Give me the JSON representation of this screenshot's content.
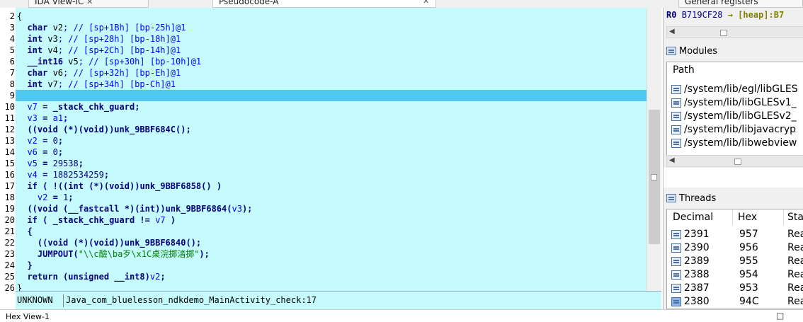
{
  "tabs": [
    {
      "label": "IDA View-IC",
      "close": "✕"
    },
    {
      "label": "Pseudocode-A",
      "close": "✕"
    },
    {
      "label": "General registers",
      "close": ""
    }
  ],
  "code_lines": [
    {
      "n": "2",
      "segments": [
        {
          "t": "{",
          "c": ""
        }
      ]
    },
    {
      "n": "3",
      "segments": [
        {
          "t": "  char ",
          "c": "kw"
        },
        {
          "t": "v2",
          "c": ""
        },
        {
          "t": "; // [sp+1Bh] [bp-25h]@1",
          "c": "cmt"
        }
      ]
    },
    {
      "n": "4",
      "segments": [
        {
          "t": "  int ",
          "c": "kw"
        },
        {
          "t": "v3",
          "c": ""
        },
        {
          "t": "; // [sp+28h] [bp-18h]@1",
          "c": "cmt"
        }
      ]
    },
    {
      "n": "5",
      "segments": [
        {
          "t": "  int ",
          "c": "kw"
        },
        {
          "t": "v4",
          "c": ""
        },
        {
          "t": "; // [sp+2Ch] [bp-14h]@1",
          "c": "cmt"
        }
      ]
    },
    {
      "n": "6",
      "segments": [
        {
          "t": "  __int16 ",
          "c": "kw"
        },
        {
          "t": "v5",
          "c": ""
        },
        {
          "t": "; // [sp+30h] [bp-10h]@1",
          "c": "cmt"
        }
      ]
    },
    {
      "n": "7",
      "segments": [
        {
          "t": "  char ",
          "c": "kw"
        },
        {
          "t": "v6",
          "c": ""
        },
        {
          "t": "; // [sp+32h] [bp-Eh]@1",
          "c": "cmt"
        }
      ]
    },
    {
      "n": "8",
      "segments": [
        {
          "t": "  int ",
          "c": "kw"
        },
        {
          "t": "v7",
          "c": ""
        },
        {
          "t": "; // [sp+34h] [bp-Ch]@1",
          "c": "cmt"
        }
      ]
    },
    {
      "n": "9",
      "segments": [
        {
          "t": "",
          "c": ""
        }
      ],
      "selected": true
    },
    {
      "n": "10",
      "segments": [
        {
          "t": "  v7",
          "c": "var"
        },
        {
          "t": " = ",
          "c": "op"
        },
        {
          "t": "_stack_chk_guard",
          "c": "fn"
        },
        {
          "t": ";",
          "c": "op"
        }
      ]
    },
    {
      "n": "11",
      "segments": [
        {
          "t": "  v3",
          "c": "var"
        },
        {
          "t": " = ",
          "c": "op"
        },
        {
          "t": "a1",
          "c": "var"
        },
        {
          "t": ";",
          "c": "op"
        }
      ]
    },
    {
      "n": "12",
      "segments": [
        {
          "t": "  ((",
          "c": "op"
        },
        {
          "t": "void",
          "c": "kw"
        },
        {
          "t": " (*)(",
          "c": "op"
        },
        {
          "t": "void",
          "c": "kw"
        },
        {
          "t": "))",
          "c": "op"
        },
        {
          "t": "unk_9BBF684C",
          "c": "fn"
        },
        {
          "t": "();",
          "c": "op"
        }
      ]
    },
    {
      "n": "13",
      "segments": [
        {
          "t": "  v2",
          "c": "var"
        },
        {
          "t": " = ",
          "c": "op"
        },
        {
          "t": "0",
          "c": "num"
        },
        {
          "t": ";",
          "c": "op"
        }
      ]
    },
    {
      "n": "14",
      "segments": [
        {
          "t": "  v6",
          "c": "var"
        },
        {
          "t": " = ",
          "c": "op"
        },
        {
          "t": "0",
          "c": "num"
        },
        {
          "t": ";",
          "c": "op"
        }
      ]
    },
    {
      "n": "15",
      "segments": [
        {
          "t": "  v5",
          "c": "var"
        },
        {
          "t": " = ",
          "c": "op"
        },
        {
          "t": "29538",
          "c": "num"
        },
        {
          "t": ";",
          "c": "op"
        }
      ]
    },
    {
      "n": "16",
      "segments": [
        {
          "t": "  v4",
          "c": "var"
        },
        {
          "t": " = ",
          "c": "op"
        },
        {
          "t": "1882534259",
          "c": "num"
        },
        {
          "t": ";",
          "c": "op"
        }
      ]
    },
    {
      "n": "17",
      "segments": [
        {
          "t": "  if",
          "c": "kw"
        },
        {
          "t": " ( ",
          "c": "op"
        },
        {
          "t": "!((",
          "c": "op"
        },
        {
          "t": "int",
          "c": "kw"
        },
        {
          "t": " (*)(",
          "c": "op"
        },
        {
          "t": "void",
          "c": "kw"
        },
        {
          "t": "))",
          "c": "op"
        },
        {
          "t": "unk_9BBF6858",
          "c": "fn"
        },
        {
          "t": "() )",
          "c": "op"
        }
      ]
    },
    {
      "n": "18",
      "segments": [
        {
          "t": "    v2",
          "c": "var"
        },
        {
          "t": " = ",
          "c": "op"
        },
        {
          "t": "1",
          "c": "num"
        },
        {
          "t": ";",
          "c": "op"
        }
      ]
    },
    {
      "n": "19",
      "segments": [
        {
          "t": "  ((",
          "c": "op"
        },
        {
          "t": "void",
          "c": "kw"
        },
        {
          "t": " (",
          "c": "op"
        },
        {
          "t": "__fastcall",
          "c": "kw"
        },
        {
          "t": " *)(",
          "c": "op"
        },
        {
          "t": "int",
          "c": "kw"
        },
        {
          "t": "))",
          "c": "op"
        },
        {
          "t": "unk_9BBF6864",
          "c": "fn"
        },
        {
          "t": "(",
          "c": "op"
        },
        {
          "t": "v3",
          "c": "var"
        },
        {
          "t": ");",
          "c": "op"
        }
      ]
    },
    {
      "n": "20",
      "segments": [
        {
          "t": "  if",
          "c": "kw"
        },
        {
          "t": " ( ",
          "c": "op"
        },
        {
          "t": "_stack_chk_guard",
          "c": "fn"
        },
        {
          "t": " != ",
          "c": "op"
        },
        {
          "t": "v7",
          "c": "var"
        },
        {
          "t": " )",
          "c": "op"
        }
      ]
    },
    {
      "n": "21",
      "segments": [
        {
          "t": "  {",
          "c": "op"
        }
      ]
    },
    {
      "n": "22",
      "segments": [
        {
          "t": "    ((",
          "c": "op"
        },
        {
          "t": "void",
          "c": "kw"
        },
        {
          "t": " (*)(",
          "c": "op"
        },
        {
          "t": "void",
          "c": "kw"
        },
        {
          "t": "))",
          "c": "op"
        },
        {
          "t": "unk_9BBF6840",
          "c": "fn"
        },
        {
          "t": "();",
          "c": "op"
        }
      ]
    },
    {
      "n": "23",
      "segments": [
        {
          "t": "    JUMPOUT",
          "c": "fn"
        },
        {
          "t": "(",
          "c": "op"
        },
        {
          "t": "\"\\\\c醶\\ba歹\\x1C桌浣掷涾掷\"",
          "c": "str"
        },
        {
          "t": ");",
          "c": "op"
        }
      ]
    },
    {
      "n": "24",
      "segments": [
        {
          "t": "  }",
          "c": "op"
        }
      ]
    },
    {
      "n": "25",
      "segments": [
        {
          "t": "  return",
          "c": "kw"
        },
        {
          "t": " (",
          "c": "op"
        },
        {
          "t": "unsigned __int8",
          "c": "kw"
        },
        {
          "t": ")",
          "c": "op"
        },
        {
          "t": "v2",
          "c": "var"
        },
        {
          "t": ";",
          "c": "op"
        }
      ]
    },
    {
      "n": "26",
      "segments": [
        {
          "t": "}",
          "c": ""
        }
      ]
    }
  ],
  "status": {
    "left": "UNKNOWN",
    "right": "Java_com_bluelesson_ndkdemo_MainActivity_check:17"
  },
  "registers": {
    "name": "R0",
    "value": "B719CF28",
    "note": "→ [heap]:B7"
  },
  "modules": {
    "title": "Modules",
    "header": "Path",
    "items": [
      "/system/lib/egl/libGLES",
      "/system/lib/libGLESv1_",
      "/system/lib/libGLESv2_",
      "/system/lib/libjavacryp",
      "/system/lib/libwebview"
    ]
  },
  "threads": {
    "title": "Threads",
    "headers": [
      "Decimal",
      "Hex",
      "Sta"
    ],
    "rows": [
      {
        "decimal": "2391",
        "hex": "957",
        "state": "Rea"
      },
      {
        "decimal": "2390",
        "hex": "956",
        "state": "Rea"
      },
      {
        "decimal": "2389",
        "hex": "955",
        "state": "Rea"
      },
      {
        "decimal": "2388",
        "hex": "954",
        "state": "Rea"
      },
      {
        "decimal": "2387",
        "hex": "953",
        "state": "Rea"
      },
      {
        "decimal": "2380",
        "hex": "94C",
        "state": "Rea"
      }
    ]
  },
  "bottom": {
    "hex_view_title": "Hex View-1",
    "controls": "□ ▣"
  },
  "colors": {
    "code_bg": "#c6fbfd",
    "selected_line": "#4fc8f1"
  }
}
